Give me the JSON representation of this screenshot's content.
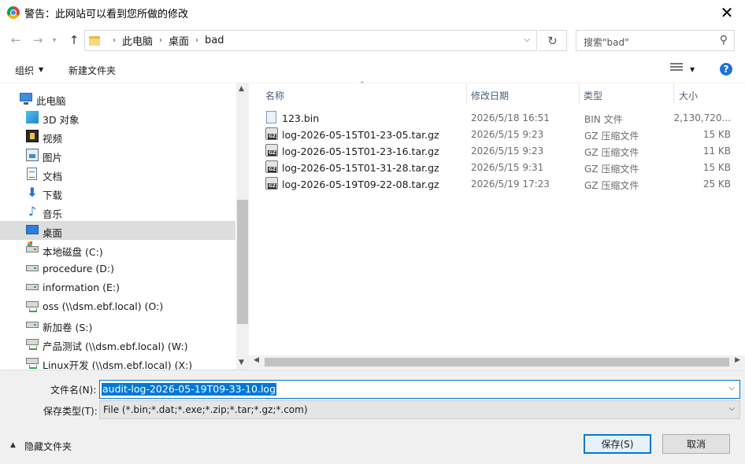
{
  "window": {
    "title": "警告：此网站可以看到您所做的修改",
    "close_glyph": "✕"
  },
  "nav": {
    "back_glyph": "←",
    "forward_glyph": "→",
    "up_glyph": "↑",
    "refresh_glyph": "↻",
    "breadcrumbs": [
      "此电脑",
      "桌面",
      "bad"
    ],
    "search_placeholder": "搜索\"bad\""
  },
  "toolbar": {
    "organize": "组织",
    "new_folder": "新建文件夹",
    "help": "?"
  },
  "tree": {
    "items": [
      {
        "label": "此电脑",
        "icon": "computer-icon"
      },
      {
        "label": "3D 对象",
        "icon": "3d-objects-icon"
      },
      {
        "label": "视频",
        "icon": "video-icon"
      },
      {
        "label": "图片",
        "icon": "pictures-icon"
      },
      {
        "label": "文档",
        "icon": "documents-icon"
      },
      {
        "label": "下载",
        "icon": "download-icon"
      },
      {
        "label": "音乐",
        "icon": "music-icon"
      },
      {
        "label": "桌面",
        "icon": "desktop-icon",
        "selected": true
      },
      {
        "label": "本地磁盘 (C:)",
        "icon": "system-drive-icon"
      },
      {
        "label": "procedure (D:)",
        "icon": "drive-icon"
      },
      {
        "label": "information (E:)",
        "icon": "drive-icon"
      },
      {
        "label": "oss (\\\\dsm.ebf.local) (O:)",
        "icon": "network-drive-icon"
      },
      {
        "label": "新加卷 (S:)",
        "icon": "drive-icon"
      },
      {
        "label": "产品测试 (\\\\dsm.ebf.local) (W:)",
        "icon": "network-drive-icon"
      },
      {
        "label": "Linux开发 (\\\\dsm.ebf.local) (X:)",
        "icon": "network-drive-icon"
      }
    ]
  },
  "files": {
    "columns": {
      "name": "名称",
      "date": "修改日期",
      "type": "类型",
      "size": "大小"
    },
    "rows": [
      {
        "name": "123.bin",
        "date": "2026/5/18 16:51",
        "type": "BIN 文件",
        "size": "2,130,720...",
        "icon": "bin-file-icon"
      },
      {
        "name": "log-2026-05-15T01-23-05.tar.gz",
        "date": "2026/5/15 9:23",
        "type": "GZ 压缩文件",
        "size": "15 KB",
        "icon": "gz-file-icon"
      },
      {
        "name": "log-2026-05-15T01-23-16.tar.gz",
        "date": "2026/5/15 9:23",
        "type": "GZ 压缩文件",
        "size": "11 KB",
        "icon": "gz-file-icon"
      },
      {
        "name": "log-2026-05-15T01-31-28.tar.gz",
        "date": "2026/5/15 9:31",
        "type": "GZ 压缩文件",
        "size": "15 KB",
        "icon": "gz-file-icon"
      },
      {
        "name": "log-2026-05-19T09-22-08.tar.gz",
        "date": "2026/5/19 17:23",
        "type": "GZ 压缩文件",
        "size": "25 KB",
        "icon": "gz-file-icon"
      }
    ]
  },
  "bottom": {
    "filename_label": "文件名(N):",
    "filename_value": "audit-log-2026-05-19T09-33-10.log",
    "filetype_label": "保存类型(T):",
    "filetype_value": "File (*.bin;*.dat;*.exe;*.zip;*.tar;*.gz;*.com)",
    "hide_folders": "隐藏文件夹",
    "save_button": "保存(S)",
    "cancel_button": "取消"
  },
  "colors": {
    "accent": "#0078d7",
    "selected_row": "#dddddd",
    "help": "#1e73d6"
  }
}
